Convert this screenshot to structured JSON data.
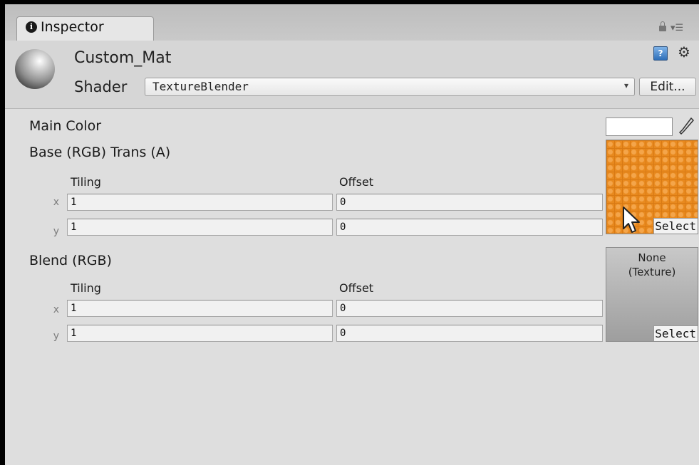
{
  "tab": {
    "label": "Inspector",
    "icon": "info-icon"
  },
  "header": {
    "material_name": "Custom_Mat",
    "shader_label": "Shader",
    "shader_value": "TextureBlender",
    "edit_label": "Edit..."
  },
  "properties": {
    "main_color": {
      "label": "Main Color",
      "value": "#ffffff"
    },
    "base_texture": {
      "label": "Base (RGB) Trans (A)",
      "tiling_label": "Tiling",
      "offset_label": "Offset",
      "x_label": "x",
      "y_label": "y",
      "tiling_x": "1",
      "tiling_y": "1",
      "offset_x": "0",
      "offset_y": "0",
      "select_label": "Select",
      "texture_color": "#e8891e"
    },
    "blend_texture": {
      "label": "Blend (RGB)",
      "tiling_label": "Tiling",
      "offset_label": "Offset",
      "x_label": "x",
      "y_label": "y",
      "tiling_x": "1",
      "tiling_y": "1",
      "offset_x": "0",
      "offset_y": "0",
      "none_label": "None\n(Texture)",
      "select_label": "Select"
    }
  }
}
